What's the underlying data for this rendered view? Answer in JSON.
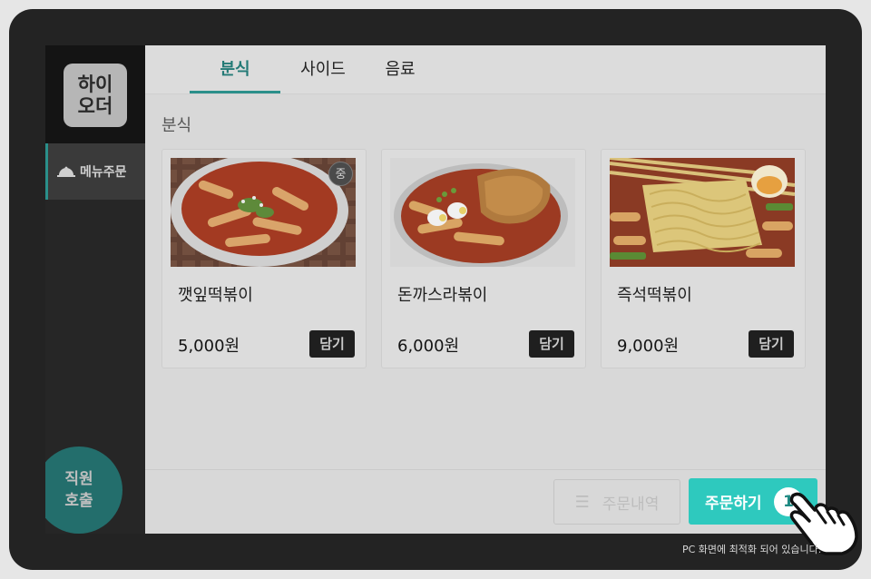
{
  "sidebar": {
    "logo_line1": "하이",
    "logo_line2": "오더",
    "nav_label": "메뉴주문",
    "call_line1": "직원",
    "call_line2": "호출"
  },
  "tabs": [
    {
      "label": "분식",
      "active": true
    },
    {
      "label": "사이드",
      "active": false
    },
    {
      "label": "음료",
      "active": false
    }
  ],
  "section_title": "분식",
  "menu_items": [
    {
      "name": "깻잎떡볶이",
      "price": "5,000원",
      "add_label": "담기",
      "badge": "중"
    },
    {
      "name": "돈까스라볶이",
      "price": "6,000원",
      "add_label": "담기"
    },
    {
      "name": "즉석떡볶이",
      "price": "9,000원",
      "add_label": "담기"
    }
  ],
  "bottom": {
    "history_label": "주문내역",
    "order_label": "주문하기",
    "order_count": "1"
  },
  "notice": "PC 화면에 최적화 되어 있습니다.",
  "colors": {
    "accent": "#2ec9be",
    "accent_dark": "#2a8f8a",
    "frame": "#232323",
    "overlay_dim": "#d9d9d9"
  }
}
